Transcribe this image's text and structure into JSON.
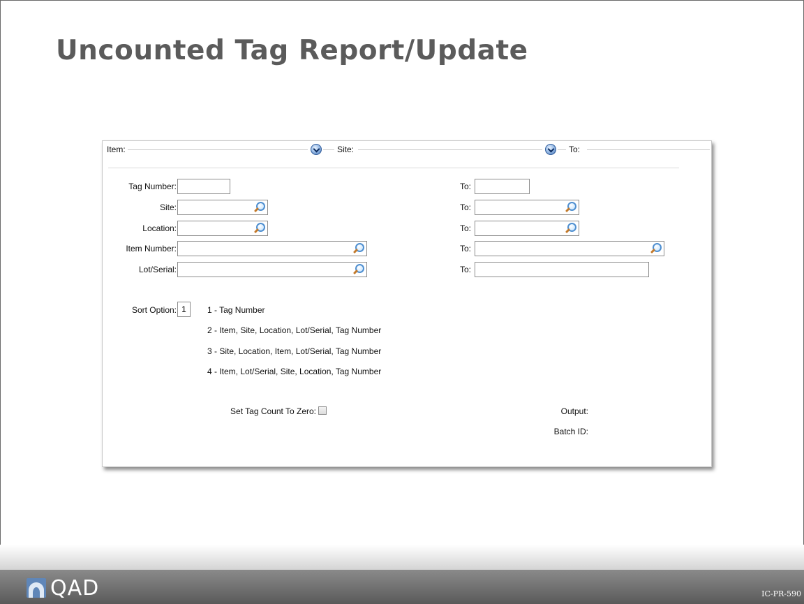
{
  "slide": {
    "title": "Uncounted Tag Report/Update",
    "doc_code": "IC-PR-590",
    "logo_text": "QAD"
  },
  "header": {
    "item_label": "Item:",
    "site_label": "Site:",
    "to_label": "To:"
  },
  "form": {
    "tag_number_label": "Tag Number:",
    "site_label": "Site:",
    "location_label": "Location:",
    "item_number_label": "Item Number:",
    "lot_serial_label": "Lot/Serial:",
    "to_label": "To:",
    "sort_option_label": "Sort Option:",
    "sort_option_value": "1",
    "sort_options": [
      "1 - Tag Number",
      "2 - Item, Site, Location, Lot/Serial, Tag Number",
      "3 - Site, Location, Item, Lot/Serial, Tag Number",
      "4 - Item, Lot/Serial, Site, Location, Tag Number"
    ],
    "set_tag_count_label": "Set Tag Count To Zero:",
    "set_tag_count_checked": false,
    "output_label": "Output:",
    "batch_id_label": "Batch ID:"
  }
}
